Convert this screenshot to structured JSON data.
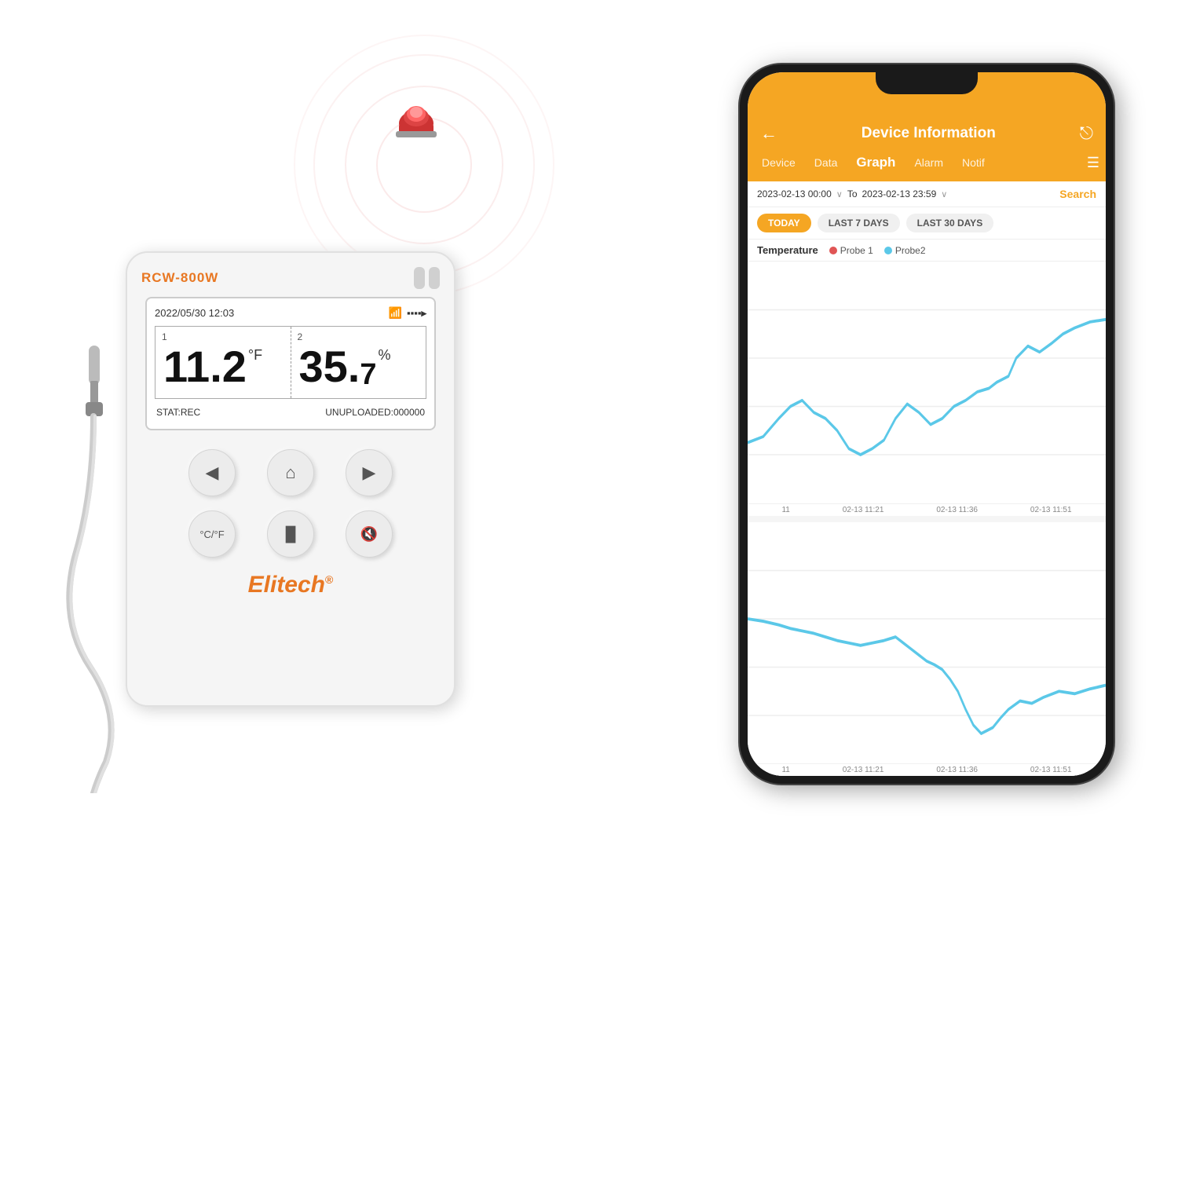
{
  "scene": {
    "background": "#ffffff"
  },
  "alarm_circles": {
    "color": "rgba(220,80,80,0.2)",
    "sizes": [
      60,
      110,
      165,
      220,
      275
    ]
  },
  "device": {
    "model": "RCW-800W",
    "datetime": "2022/05/30  12:03",
    "channel1": {
      "num": "1",
      "value": "11.2",
      "unit": "°F"
    },
    "channel2": {
      "num": "2",
      "value": "35.",
      "value2": "7",
      "unit": "%"
    },
    "status": "STAT:REC",
    "unuploaded": "UNUPLOADED:000000",
    "buttons": {
      "row1": [
        "◀",
        "⌂",
        "▶"
      ],
      "row2": [
        "°C/°F",
        "▐▌",
        "🔇"
      ]
    },
    "brand": "Elitech",
    "brand_symbol": "®"
  },
  "phone": {
    "header": {
      "title": "Device Information",
      "back_icon": "←",
      "share_icon": "⎋"
    },
    "nav_tabs": [
      {
        "label": "Device",
        "active": false
      },
      {
        "label": "Data",
        "active": false
      },
      {
        "label": "Graph",
        "active": true
      },
      {
        "label": "Alarm",
        "active": false
      },
      {
        "label": "Notif",
        "active": false
      }
    ],
    "date_range": {
      "from": "2023-02-13 00:00",
      "to": "2023-02-13 23:59",
      "arrow": "∨",
      "search": "Search"
    },
    "filters": [
      {
        "label": "TODAY",
        "active": true
      },
      {
        "label": "LAST 7 DAYS",
        "active": false
      },
      {
        "label": "LAST 30 DAYS",
        "active": false
      }
    ],
    "legend": {
      "label": "Temperature",
      "items": [
        {
          "name": "Probe 1",
          "color": "#e05555"
        },
        {
          "name": "Probe2",
          "color": "#5bc8e8"
        }
      ]
    },
    "chart": {
      "x_labels_top": [
        "11",
        "02-13 11:21",
        "02-13 11:36",
        "02-13 11:51"
      ],
      "x_labels_bottom": [
        "11",
        "02-13 11:21",
        "02-13 11:36",
        "02-13 11:51"
      ],
      "probe1_color": "#5bc8e8",
      "probe2_color": "#5bc8e8"
    }
  }
}
